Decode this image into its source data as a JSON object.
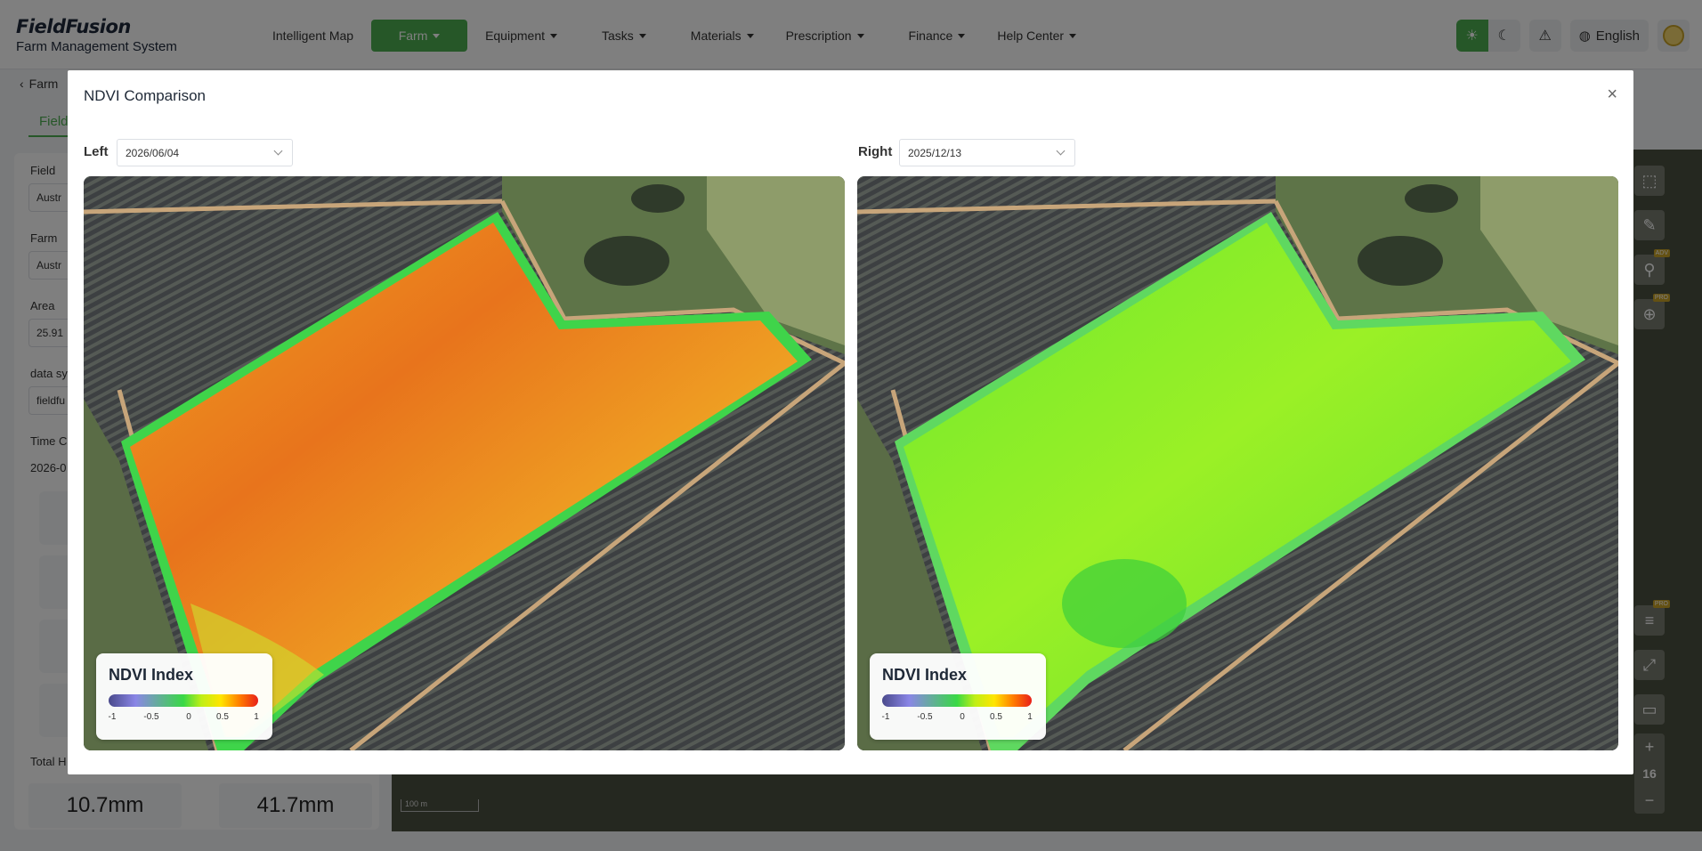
{
  "app": {
    "brand_name": "FieldFusion",
    "brand_sub": "Farm Management System"
  },
  "nav": {
    "items": [
      {
        "label": "Intelligent Map",
        "caret": false
      },
      {
        "label": "Farm",
        "caret": true,
        "active": true
      },
      {
        "label": "Equipment",
        "caret": true
      },
      {
        "label": "Tasks",
        "caret": true
      },
      {
        "label": "Materials",
        "caret": true
      },
      {
        "label": "Prescription",
        "caret": true
      },
      {
        "label": "Finance",
        "caret": true
      },
      {
        "label": "Help Center",
        "caret": true
      }
    ],
    "language": "English",
    "accent_color": "#4caf50"
  },
  "background": {
    "breadcrumb": "Farm",
    "subtab": "Field",
    "labels": {
      "field": "Field",
      "farm": "Farm",
      "area": "Area",
      "data_source": "data sy",
      "time": "Time C",
      "total": "Total H"
    },
    "values": {
      "field": "Austr",
      "farm": "Austr",
      "area": "25.91",
      "data_source": "fieldfu",
      "time": "2026-0"
    },
    "stats": [
      "10.7mm",
      "41.7mm"
    ],
    "zoom_level": "16",
    "scale_label": "100 m"
  },
  "modal": {
    "title": "NDVI Comparison",
    "close_glyph": "×",
    "left": {
      "label": "Left",
      "date": "2026/06/04"
    },
    "right": {
      "label": "Right",
      "date": "2025/12/13"
    },
    "legend": {
      "title": "NDVI Index",
      "ticks": [
        "-1",
        "-0.5",
        "0",
        "0.5",
        "1"
      ]
    }
  },
  "icons": {
    "close": "close-icon",
    "chevron": "chevron-down-icon",
    "sun": "sun-icon",
    "moon": "moon-icon",
    "alert": "alarm-icon",
    "globe": "globe-icon"
  }
}
